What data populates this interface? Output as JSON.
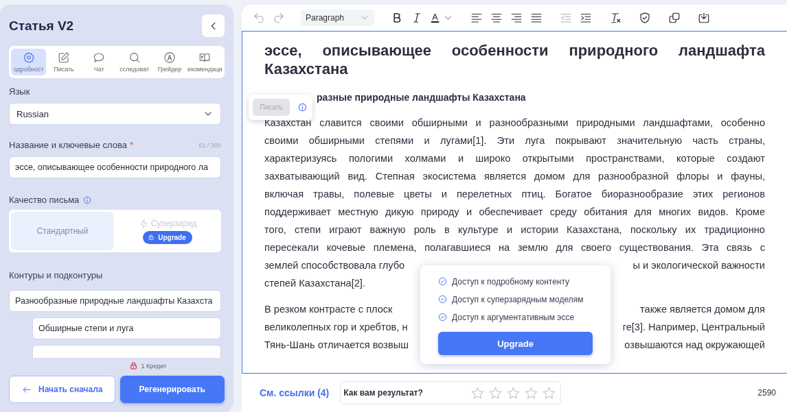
{
  "sidebar": {
    "title": "Статья V2",
    "tabs": [
      {
        "label": "одробност",
        "selected": true
      },
      {
        "label": "Писать",
        "selected": false
      },
      {
        "label": "Чат",
        "selected": false
      },
      {
        "label": "сследоват",
        "selected": false
      },
      {
        "label": "Грейдер",
        "selected": false
      },
      {
        "label": "екомендаци",
        "selected": false
      }
    ],
    "language": {
      "label": "Язык",
      "value": "Russian"
    },
    "keywords": {
      "label": "Название и ключевые слова",
      "required_mark": "*",
      "counter": "61 / 300",
      "value": "эссе, описывающее особенности природного ла"
    },
    "quality": {
      "label": "Качество письма",
      "options": [
        {
          "label": "Стандартный",
          "selected": true,
          "locked": false
        },
        {
          "label": "Суперзаряд",
          "selected": false,
          "locked": true,
          "badge": "Upgrade"
        }
      ]
    },
    "outline": {
      "label": "Контуры и подконтуры",
      "items": [
        {
          "kind": "text",
          "text": "Разнообразные природные ландшафты Казахста",
          "children": [
            {
              "kind": "text",
              "text": "Обширные степи и луга"
            },
            {
              "kind": "empty"
            }
          ]
        }
      ]
    },
    "credit": "1 Кредит",
    "buttons": [
      {
        "label": "Начать сначала",
        "kind": "secondary"
      },
      {
        "label": "Регенерировать",
        "kind": "primary"
      }
    ]
  },
  "toolbar": {
    "block_style": "Paragraph",
    "buttons": [
      {
        "disabled": true
      },
      {
        "disabled": true
      },
      {
        "disabled": false
      },
      {
        "disabled": false
      },
      {
        "disabled": false
      },
      {
        "disabled": false
      },
      {
        "disabled": false
      },
      {
        "disabled": false
      },
      {
        "disabled": false
      },
      {
        "disabled": true
      },
      {
        "disabled": false
      },
      {
        "disabled": false
      },
      {
        "disabled": false
      },
      {
        "disabled": false
      },
      {
        "disabled": false
      }
    ]
  },
  "editor": {
    "title": "эссе, описывающее особенности природного ландшафта Казахстана",
    "heading": "разные природные ландшафты Казахстана",
    "paragraphs": [
      {
        "lines": [
          {
            "text": "Казахстан славится своими обширными и разнообразными природными ландшафтами, особенно"
          },
          {
            "text": "своими обширными степями и лугами[1]. Эти луга покрывают значительную часть страны,"
          },
          {
            "text": "характеризуясь пологими холмами и широко открытыми пространствами, которые создают"
          },
          {
            "text": "захватывающий вид. Степная экосистема является домом для разнообразной флоры и фауны,"
          },
          {
            "text": "включая травы, полевые цветы и перелетных птиц. Богатое биоразнообразие этих регионов"
          },
          {
            "text": "поддерживает местную дикую природу и обеспечивает среду обитания для многих видов. Кроме"
          },
          {
            "text": "того, степи играют важную роль в культуре и истории Казахстана, поскольку их традиционно"
          },
          {
            "text": "пересекали кочевые племена, полагавшиеся на землю для своего существования. Эта связь с"
          },
          {
            "left": "землей способствовала глубо",
            "right": "ы и экологической важности"
          },
          {
            "text": "степей Казахстана[2]."
          }
        ]
      },
      {
        "lines": [
          {
            "left": "В резком контрасте с плоск",
            "right": "также является домом для"
          },
          {
            "left": "великолепных гор и хребтов, н",
            "right": "ге[3]. Например, Центральный"
          },
          {
            "left": "Тянь-Шань отличается возвыш",
            "right": "озвышаются над окружающей"
          }
        ]
      }
    ],
    "write_popup": {
      "button": "Писать",
      "disabled": true
    },
    "upgrade_popup": {
      "features": [
        "Доступ к подробному контенту",
        "Доступ к суперзарядным моделям",
        "Доступ к аргументативным эссе"
      ],
      "button": "Upgrade"
    }
  },
  "footer": {
    "references": "См. ссылки (4)",
    "rating": {
      "question": "Как вам результат?",
      "stars": 0
    },
    "word_count": "2590"
  }
}
